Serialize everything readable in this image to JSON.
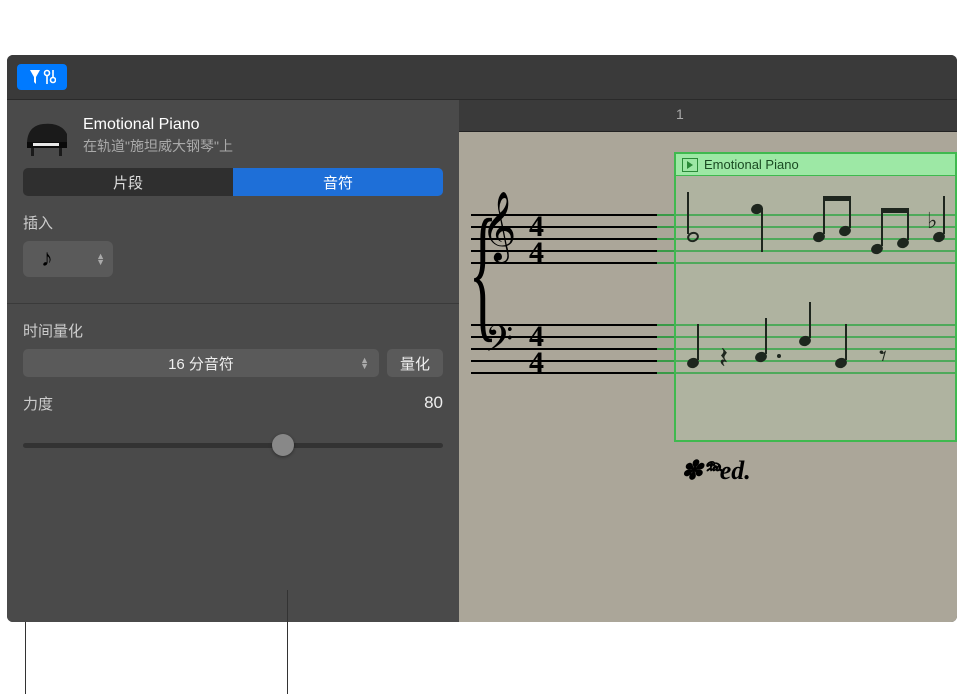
{
  "region": {
    "name": "Emotional Piano",
    "track_info": "在轨道\"施坦威大钢琴\"上"
  },
  "tabs": {
    "clips": "片段",
    "notes": "音符"
  },
  "insert": {
    "label": "插入"
  },
  "quantize": {
    "label": "时间量化",
    "value": "16 分音符",
    "button": "量化"
  },
  "velocity": {
    "label": "力度",
    "value": "80"
  },
  "ruler": {
    "bar": "1"
  },
  "score_region": {
    "title": "Emotional Piano",
    "pedal": "✽𝆮ed."
  },
  "timesig": {
    "num": "4",
    "den": "4"
  }
}
